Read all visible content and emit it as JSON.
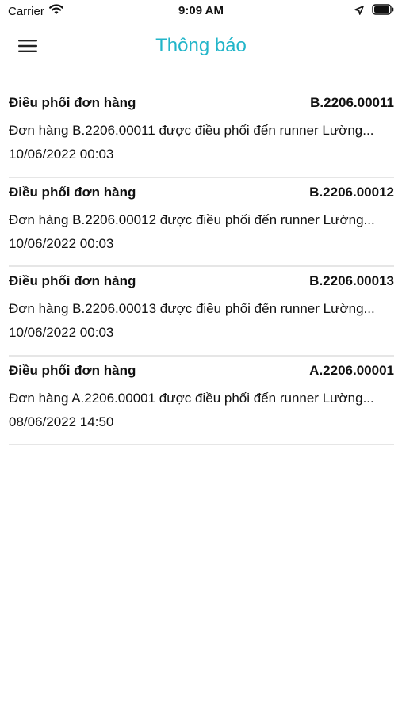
{
  "status_bar": {
    "carrier": "Carrier",
    "time": "9:09 AM"
  },
  "header": {
    "title": "Thông báo",
    "title_color": "#22b5c9"
  },
  "icons": {
    "menu": "hamburger-menu-icon",
    "wifi": "wifi-icon",
    "location": "location-arrow-icon",
    "battery": "battery-icon"
  },
  "notifications": [
    {
      "title": "Điều phối đơn hàng",
      "code": "B.2206.00011",
      "message": "Đơn hàng B.2206.00011 được điều phối đến runner Lường...",
      "date": "10/06/2022 00:03"
    },
    {
      "title": "Điều phối đơn hàng",
      "code": "B.2206.00012",
      "message": "Đơn hàng B.2206.00012 được điều phối đến runner Lường...",
      "date": "10/06/2022 00:03"
    },
    {
      "title": "Điều phối đơn hàng",
      "code": "B.2206.00013",
      "message": "Đơn hàng B.2206.00013 được điều phối đến runner Lường...",
      "date": "10/06/2022 00:03"
    },
    {
      "title": "Điều phối đơn hàng",
      "code": "A.2206.00001",
      "message": "Đơn hàng A.2206.00001 được điều phối đến runner Lường...",
      "date": "08/06/2022 14:50"
    }
  ]
}
